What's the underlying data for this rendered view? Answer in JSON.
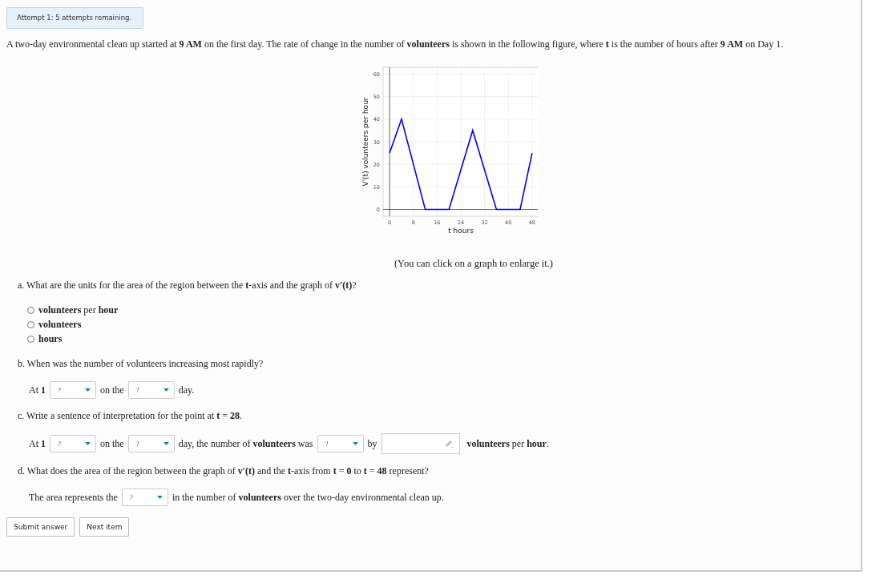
{
  "attempt_banner": "Attempt 1: 5 attempts remaining.",
  "intro": "A two-day environmental clean up started at **9 AM** on the first day. The rate of change in the number of **volunteers** is shown in the following figure, where **t** is the number of hours after **9 AM** on Day 1.",
  "figure": {
    "chart_data": {
      "type": "line",
      "xlabel": "t hours",
      "ylabel": "V'(t) volunteers per hour",
      "x": [
        0,
        4,
        12,
        20,
        28,
        36,
        44,
        48
      ],
      "grid": true,
      "series": [
        {
          "color": "#0000ff",
          "values": [
            25,
            40,
            0,
            0,
            35,
            0,
            0,
            25
          ]
        }
      ],
      "xlim": [
        -2.2,
        50.2
      ],
      "ylim": [
        -3,
        63
      ],
      "xticks": [
        0,
        8,
        16,
        24,
        32,
        40,
        48
      ],
      "yticks": [
        0,
        10,
        20,
        30,
        40,
        50,
        60
      ]
    },
    "caption": "(You can click on a graph to enlarge it.)"
  },
  "questions": [
    {
      "prompt": "a. What are the units for the area of the region between the **t**-axis and the graph of **v′(t)**?",
      "choices": [
        {
          "label": "**volunteers** per **hour**",
          "selected": false
        },
        {
          "label": "**volunteers**",
          "selected": false
        },
        {
          "label": "**hours**",
          "selected": false
        }
      ]
    },
    {
      "prompt": "b. When was the number of volunteers increasing most rapidly?",
      "answer": [
        {
          "kind": "text",
          "text": "At **1**"
        },
        {
          "kind": "select",
          "value": "?"
        },
        {
          "kind": "text",
          "text": "on the"
        },
        {
          "kind": "select",
          "value": "?"
        },
        {
          "kind": "text",
          "text": "day."
        }
      ]
    },
    {
      "prompt": "c. Write a sentence of interpretation for the point at **t** = **28**.",
      "answer": [
        {
          "kind": "text",
          "text": "At **1**"
        },
        {
          "kind": "select",
          "value": "?"
        },
        {
          "kind": "text",
          "text": "on the"
        },
        {
          "kind": "select",
          "value": "?"
        },
        {
          "kind": "text",
          "text": "day, the number of **volunteers** was"
        },
        {
          "kind": "select",
          "value": "?"
        },
        {
          "kind": "text",
          "text": "by"
        },
        {
          "kind": "input"
        },
        {
          "kind": "text",
          "text": "**volunteers** per **hour**."
        }
      ]
    },
    {
      "prompt": "d. What does the area of the region between the graph of **v′(t)** and the **t**-axis from **t** = **0** to **t** = **48** represent?",
      "answer": [
        {
          "kind": "text",
          "text": "The area represents the"
        },
        {
          "kind": "select",
          "value": "?"
        },
        {
          "kind": "text",
          "text": "in the number of **volunteers** over the two-day environmental clean up."
        }
      ]
    }
  ],
  "buttons": [
    "Submit answer",
    "Next item"
  ]
}
